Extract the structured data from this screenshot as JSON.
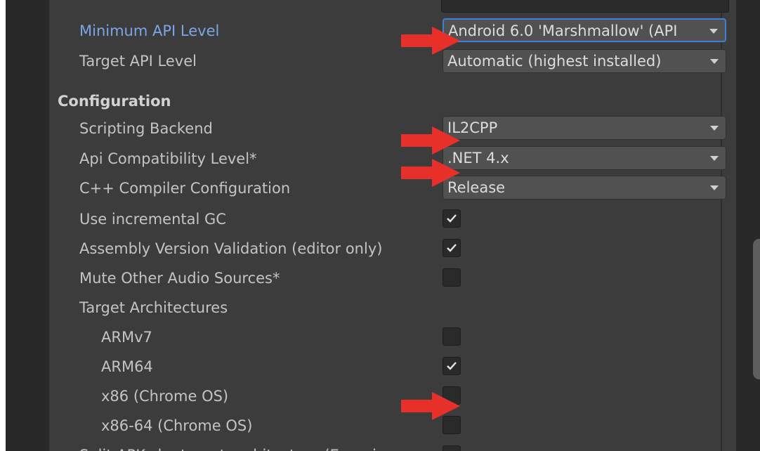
{
  "player_settings": {
    "minimum_api_level": {
      "label": "Minimum API Level",
      "value": "Android 6.0 'Marshmallow' (API"
    },
    "target_api_level": {
      "label": "Target API Level",
      "value": "Automatic (highest installed)"
    },
    "configuration": {
      "header": "Configuration",
      "scripting_backend": {
        "label": "Scripting Backend",
        "value": "IL2CPP"
      },
      "api_compatibility_level": {
        "label": "Api Compatibility Level*",
        "value": ".NET 4.x"
      },
      "cpp_compiler_configuration": {
        "label": "C++ Compiler Configuration",
        "value": "Release"
      },
      "use_incremental_gc": {
        "label": "Use incremental GC",
        "checked": true
      },
      "assembly_version_validation": {
        "label": "Assembly Version Validation (editor only)",
        "checked": true
      },
      "mute_other_audio_sources": {
        "label": "Mute Other Audio Sources*",
        "checked": false
      },
      "target_architectures": {
        "label": "Target Architectures",
        "items": [
          {
            "label": "ARMv7",
            "checked": false
          },
          {
            "label": "ARM64",
            "checked": true
          },
          {
            "label": "x86 (Chrome OS)",
            "checked": false
          },
          {
            "label": "x86-64 (Chrome OS)",
            "checked": false
          }
        ]
      },
      "split_apks_partial_label": "Split APKs by target architecture (Experi"
    }
  },
  "annotation_arrows": {
    "count": 4,
    "color": "#e8302b",
    "icon": "right-arrow-icon"
  }
}
